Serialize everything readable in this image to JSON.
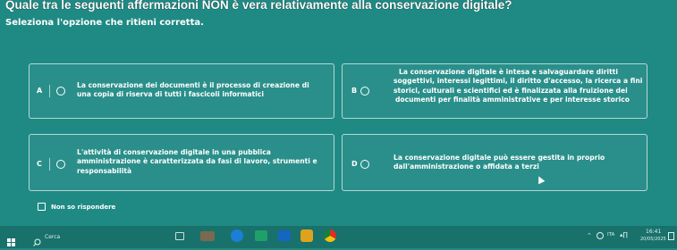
{
  "question": "Quale tra le seguenti affermazioni NON è vera relativamente alla conservazione digitale?",
  "instruction": "Seleziona l'opzione che ritieni corretta.",
  "options": [
    {
      "letter": "A",
      "lines": [
        "La conservazione dei documenti è il processo di creazione di",
        "una copia di riserva di tutti i fascicoli informatici"
      ]
    },
    {
      "letter": "B",
      "lines": [
        "La conservazione digitale è intesa e salvaguardare diritti",
        "soggettivi, interessi legittimi, il diritto d'accesso, la ricerca a fini",
        "storici, culturali e scientifici ed è finalizzata alla fruizione dei",
        "documenti per finalità amministrative e per interesse storico"
      ]
    },
    {
      "letter": "C",
      "lines": [
        "L'attività di conservazione digitale in una pubblica",
        "amministrazione è caratterizzata da fasi di lavoro, strumenti e",
        "responsabilità"
      ]
    },
    {
      "letter": "D",
      "lines": [
        "La conservazione digitale può essere gestita in proprio",
        "dall'amministrazione o affidata a terzi"
      ]
    }
  ],
  "dont_know": "Non so rispondere",
  "taskbar": {
    "search_placeholder": "Cerca",
    "time": "16:41",
    "date": "20/05/2025"
  }
}
